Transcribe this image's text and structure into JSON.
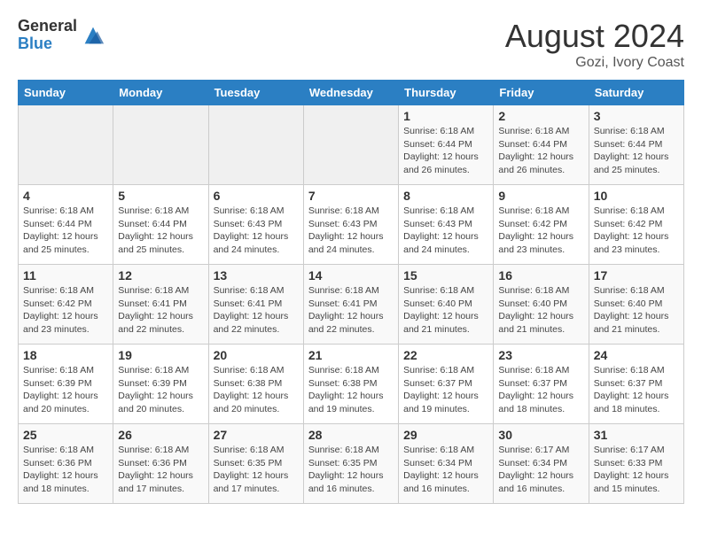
{
  "header": {
    "logo_general": "General",
    "logo_blue": "Blue",
    "month_year": "August 2024",
    "location": "Gozi, Ivory Coast"
  },
  "weekdays": [
    "Sunday",
    "Monday",
    "Tuesday",
    "Wednesday",
    "Thursday",
    "Friday",
    "Saturday"
  ],
  "weeks": [
    [
      {
        "day": "",
        "info": ""
      },
      {
        "day": "",
        "info": ""
      },
      {
        "day": "",
        "info": ""
      },
      {
        "day": "",
        "info": ""
      },
      {
        "day": "1",
        "info": "Sunrise: 6:18 AM\nSunset: 6:44 PM\nDaylight: 12 hours and 26 minutes."
      },
      {
        "day": "2",
        "info": "Sunrise: 6:18 AM\nSunset: 6:44 PM\nDaylight: 12 hours and 26 minutes."
      },
      {
        "day": "3",
        "info": "Sunrise: 6:18 AM\nSunset: 6:44 PM\nDaylight: 12 hours and 25 minutes."
      }
    ],
    [
      {
        "day": "4",
        "info": "Sunrise: 6:18 AM\nSunset: 6:44 PM\nDaylight: 12 hours and 25 minutes."
      },
      {
        "day": "5",
        "info": "Sunrise: 6:18 AM\nSunset: 6:44 PM\nDaylight: 12 hours and 25 minutes."
      },
      {
        "day": "6",
        "info": "Sunrise: 6:18 AM\nSunset: 6:43 PM\nDaylight: 12 hours and 24 minutes."
      },
      {
        "day": "7",
        "info": "Sunrise: 6:18 AM\nSunset: 6:43 PM\nDaylight: 12 hours and 24 minutes."
      },
      {
        "day": "8",
        "info": "Sunrise: 6:18 AM\nSunset: 6:43 PM\nDaylight: 12 hours and 24 minutes."
      },
      {
        "day": "9",
        "info": "Sunrise: 6:18 AM\nSunset: 6:42 PM\nDaylight: 12 hours and 23 minutes."
      },
      {
        "day": "10",
        "info": "Sunrise: 6:18 AM\nSunset: 6:42 PM\nDaylight: 12 hours and 23 minutes."
      }
    ],
    [
      {
        "day": "11",
        "info": "Sunrise: 6:18 AM\nSunset: 6:42 PM\nDaylight: 12 hours and 23 minutes."
      },
      {
        "day": "12",
        "info": "Sunrise: 6:18 AM\nSunset: 6:41 PM\nDaylight: 12 hours and 22 minutes."
      },
      {
        "day": "13",
        "info": "Sunrise: 6:18 AM\nSunset: 6:41 PM\nDaylight: 12 hours and 22 minutes."
      },
      {
        "day": "14",
        "info": "Sunrise: 6:18 AM\nSunset: 6:41 PM\nDaylight: 12 hours and 22 minutes."
      },
      {
        "day": "15",
        "info": "Sunrise: 6:18 AM\nSunset: 6:40 PM\nDaylight: 12 hours and 21 minutes."
      },
      {
        "day": "16",
        "info": "Sunrise: 6:18 AM\nSunset: 6:40 PM\nDaylight: 12 hours and 21 minutes."
      },
      {
        "day": "17",
        "info": "Sunrise: 6:18 AM\nSunset: 6:40 PM\nDaylight: 12 hours and 21 minutes."
      }
    ],
    [
      {
        "day": "18",
        "info": "Sunrise: 6:18 AM\nSunset: 6:39 PM\nDaylight: 12 hours and 20 minutes."
      },
      {
        "day": "19",
        "info": "Sunrise: 6:18 AM\nSunset: 6:39 PM\nDaylight: 12 hours and 20 minutes."
      },
      {
        "day": "20",
        "info": "Sunrise: 6:18 AM\nSunset: 6:38 PM\nDaylight: 12 hours and 20 minutes."
      },
      {
        "day": "21",
        "info": "Sunrise: 6:18 AM\nSunset: 6:38 PM\nDaylight: 12 hours and 19 minutes."
      },
      {
        "day": "22",
        "info": "Sunrise: 6:18 AM\nSunset: 6:37 PM\nDaylight: 12 hours and 19 minutes."
      },
      {
        "day": "23",
        "info": "Sunrise: 6:18 AM\nSunset: 6:37 PM\nDaylight: 12 hours and 18 minutes."
      },
      {
        "day": "24",
        "info": "Sunrise: 6:18 AM\nSunset: 6:37 PM\nDaylight: 12 hours and 18 minutes."
      }
    ],
    [
      {
        "day": "25",
        "info": "Sunrise: 6:18 AM\nSunset: 6:36 PM\nDaylight: 12 hours and 18 minutes."
      },
      {
        "day": "26",
        "info": "Sunrise: 6:18 AM\nSunset: 6:36 PM\nDaylight: 12 hours and 17 minutes."
      },
      {
        "day": "27",
        "info": "Sunrise: 6:18 AM\nSunset: 6:35 PM\nDaylight: 12 hours and 17 minutes."
      },
      {
        "day": "28",
        "info": "Sunrise: 6:18 AM\nSunset: 6:35 PM\nDaylight: 12 hours and 16 minutes."
      },
      {
        "day": "29",
        "info": "Sunrise: 6:18 AM\nSunset: 6:34 PM\nDaylight: 12 hours and 16 minutes."
      },
      {
        "day": "30",
        "info": "Sunrise: 6:17 AM\nSunset: 6:34 PM\nDaylight: 12 hours and 16 minutes."
      },
      {
        "day": "31",
        "info": "Sunrise: 6:17 AM\nSunset: 6:33 PM\nDaylight: 12 hours and 15 minutes."
      }
    ]
  ]
}
